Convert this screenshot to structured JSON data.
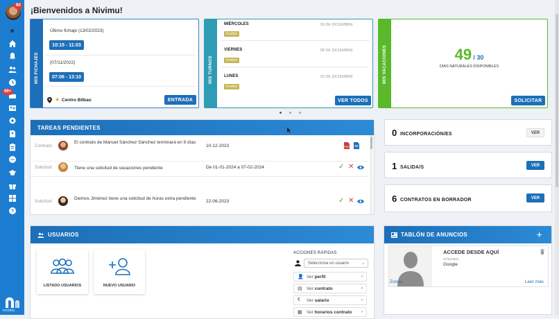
{
  "sidebar": {
    "notifications_badge": "90",
    "alerts_badge": "99+",
    "logo_text": "nivimu"
  },
  "header": {
    "welcome": "¡Bienvenidos a Nivimu!"
  },
  "fichajes": {
    "strip_label": "MIS FICHAJES",
    "last_label": "Último fichaje (13/02/2023)",
    "last_time": "10:15 - 11:03",
    "prev_label": "(07/11/2022)",
    "prev_time": "07:06 - 13:10",
    "location": "Centro Bilbao",
    "button": "ENTRADA"
  },
  "turnos": {
    "strip_label": "MIS TURNOS",
    "items": [
      {
        "day": "MIÉRCOLES",
        "date": "06 DE DICIEMBRE",
        "tag": "Festivo"
      },
      {
        "day": "VIERNES",
        "date": "08 DE DICIEMBRE",
        "tag": "Festivo"
      },
      {
        "day": "LUNES",
        "date": "25 DE DICIEMBRE",
        "tag": "Festivo"
      }
    ],
    "button": "VER TODOS"
  },
  "vacaciones": {
    "strip_label": "MIS VACACIONES",
    "available": "49",
    "total": "/ 30",
    "caption": "DÍAS NATURALES DISPONIBLES",
    "button": "SOLICITAR"
  },
  "tareas": {
    "title": "TAREAS PENDIENTES",
    "rows": [
      {
        "type": "Contrato",
        "text": "El contrato de Manuel Sánchez Sánchez terminará en 9 días",
        "date": "10-12-2023"
      },
      {
        "type": "Solicitud",
        "text": "Tiene una solicitud de vacaciones pendiente",
        "date": "De 01-01-2024 a 07-02-2024"
      },
      {
        "type": "Solicitud",
        "text": "Deimos Jiménez tiene una solicitud de horas extra pendiente",
        "date": "22-06-2023"
      }
    ]
  },
  "counts": [
    {
      "num": "0",
      "label": "INCORPORACIÓN/ES",
      "button": "VER"
    },
    {
      "num": "1",
      "label": "SALIDA/S",
      "button": "VER"
    },
    {
      "num": "6",
      "label": "CONTRATOS EN BORRADOR",
      "button": "VER"
    }
  ],
  "usuarios": {
    "title": "USUARIOS",
    "tile_list": "LISTADO USUARIOS",
    "tile_new": "NUEVO USUARIO",
    "quick_title": "ACCIONES RÁPIDAS",
    "select_placeholder": "Selecciona un usuario",
    "actions": [
      {
        "prefix": "Ver",
        "bold": "perfil"
      },
      {
        "prefix": "Ver",
        "bold": "contrato"
      },
      {
        "prefix": "Ver",
        "bold": "salario"
      },
      {
        "prefix": "Ver",
        "bold": "horarios contrato"
      }
    ]
  },
  "anuncios": {
    "title": "TABLÓN DE ANUNCIOS",
    "card_title": "ACCEDE DESDE AQUÍ",
    "card_date": "07/11/2022",
    "card_source": "Google",
    "link_left": "Zonas",
    "link_right": "Leer más"
  },
  "colors": {
    "primary": "#1c6fb8",
    "sidebar": "#1c7dd0",
    "green": "#5ab92a",
    "teal": "#2f9bb4"
  }
}
